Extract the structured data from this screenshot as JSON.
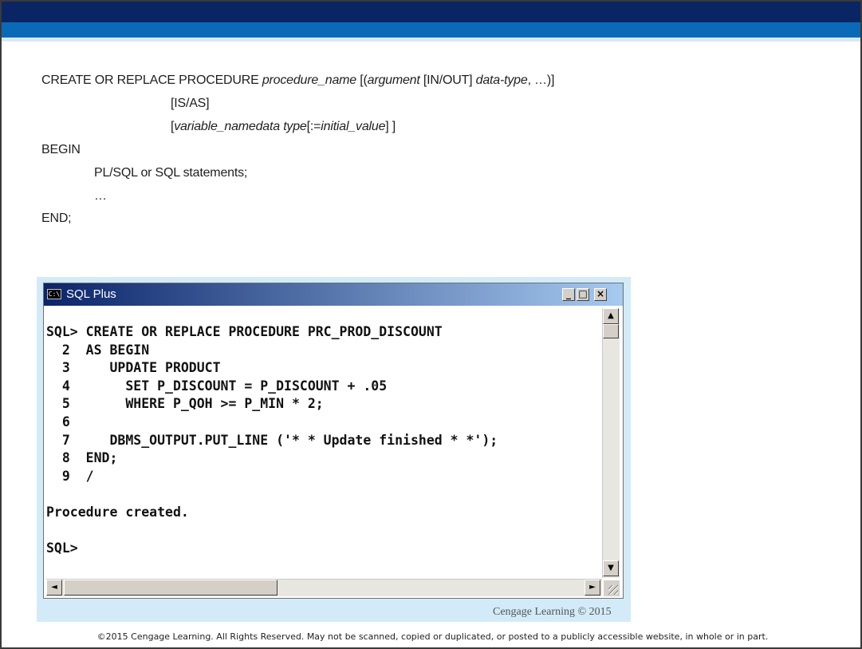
{
  "syntax": {
    "line1_kw": "CREATE OR REPLACE PROCEDURE ",
    "line1_name": "procedure_name",
    "line1_open": " [(",
    "line1_arg": "argument",
    "line1_inout": " [IN/OUT] ",
    "line1_type": "data-type",
    "line1_close": ", …)]",
    "line2": "[IS/AS]",
    "line3_open": "[",
    "line3_var": "variable_namedata type",
    "line3_assign": "[:=",
    "line3_init": "initial_value",
    "line3_close": "] ]",
    "line4": "BEGIN",
    "line5": "PL/SQL or SQL statements;",
    "line6": "…",
    "line7": "END;"
  },
  "window": {
    "title": "SQL Plus",
    "icon_text": "C:\\",
    "minimize": "_",
    "maximize": "□",
    "close": "×",
    "scroll_up": "▲",
    "scroll_down": "▼",
    "scroll_left": "◄",
    "scroll_right": "►"
  },
  "console": {
    "lines": [
      "SQL> CREATE OR REPLACE PROCEDURE PRC_PROD_DISCOUNT",
      "  2  AS BEGIN",
      "  3     UPDATE PRODUCT",
      "  4       SET P_DISCOUNT = P_DISCOUNT + .05",
      "  5       WHERE P_QOH >= P_MIN * 2;",
      "  6",
      "  7     DBMS_OUTPUT.PUT_LINE ('* * Update finished * *');",
      "  8  END;",
      "  9  /",
      "",
      "Procedure created.",
      "",
      "SQL>"
    ]
  },
  "credit": "Cengage Learning © 2015",
  "footer": "©2015 Cengage Learning. All Rights Reserved. May not be scanned, copied or duplicated, or posted to a publicly accessible website, in whole or in part.",
  "colors": {
    "banner_dark": "#0a2563",
    "banner_blue": "#0b6ab8",
    "titlebar_start": "#0a246a",
    "titlebar_end": "#a6caf0",
    "screenshot_bg": "#d3ebf8"
  }
}
